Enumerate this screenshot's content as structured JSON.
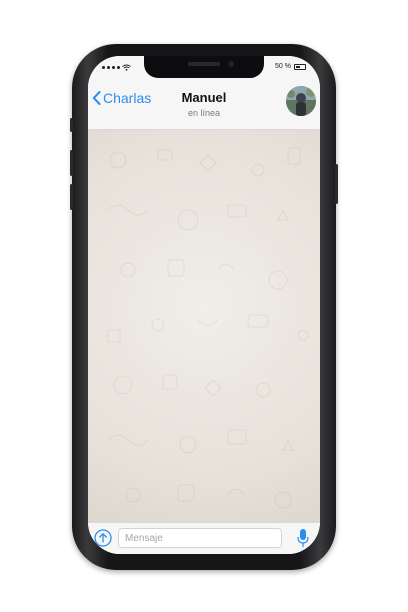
{
  "status_bar": {
    "battery": "50 %"
  },
  "header": {
    "back_label": "Charlas",
    "contact_name": "Manuel",
    "contact_status": "en línea",
    "accent_color": "#2c8df0"
  },
  "input_bar": {
    "placeholder": "Mensaje",
    "value": ""
  },
  "icons": [
    "chevron-left-icon",
    "upload-arrow-icon",
    "microphone-icon",
    "wifi-icon",
    "battery-icon",
    "signal-icon"
  ]
}
